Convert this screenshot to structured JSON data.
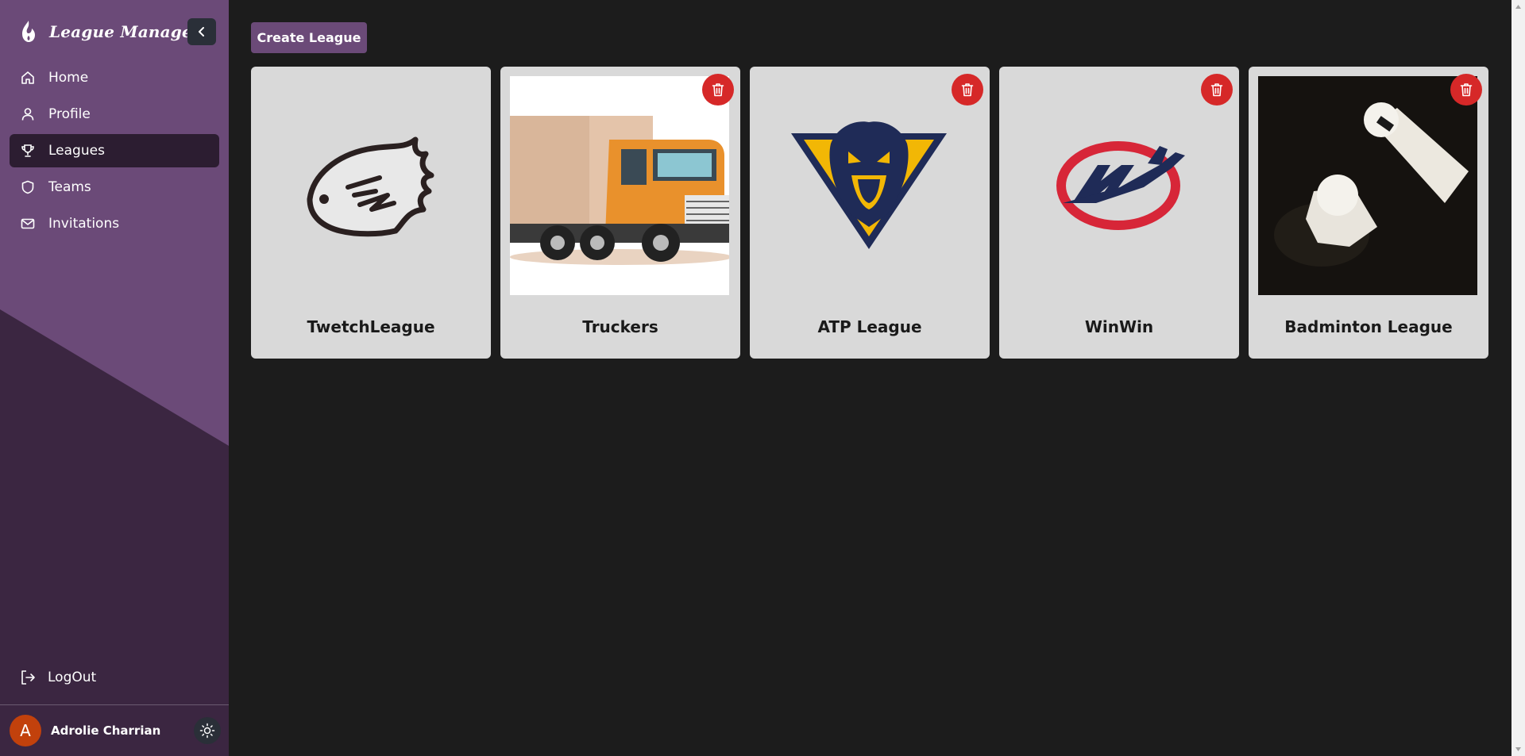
{
  "app": {
    "title": "League Manager"
  },
  "sidebar": {
    "items": [
      {
        "label": "Home",
        "icon": "home-icon"
      },
      {
        "label": "Profile",
        "icon": "user-icon"
      },
      {
        "label": "Leagues",
        "icon": "trophy-icon",
        "active": true
      },
      {
        "label": "Teams",
        "icon": "shield-icon"
      },
      {
        "label": "Invitations",
        "icon": "mail-icon"
      }
    ],
    "logout_label": "LogOut",
    "user": {
      "initial": "A",
      "name": "Adrolie Charrian"
    }
  },
  "main": {
    "create_label": "Create League",
    "leagues": [
      {
        "name": "TwetchLeague",
        "logo": "beaver-logo",
        "deletable": false
      },
      {
        "name": "Truckers",
        "logo": "truck-image",
        "deletable": true
      },
      {
        "name": "ATP League",
        "logo": "panther-logo",
        "deletable": true
      },
      {
        "name": "WinWin",
        "logo": "jet-logo",
        "deletable": true
      },
      {
        "name": "Badminton League",
        "logo": "shuttlecock-photo",
        "deletable": true
      }
    ]
  },
  "colors": {
    "sidebar_light": "#6b4a78",
    "sidebar_dark": "#3b2641",
    "accent": "#6b4a78",
    "danger": "#d62828",
    "card_bg": "#d9d9d9",
    "page_bg": "#1c1c1c"
  }
}
